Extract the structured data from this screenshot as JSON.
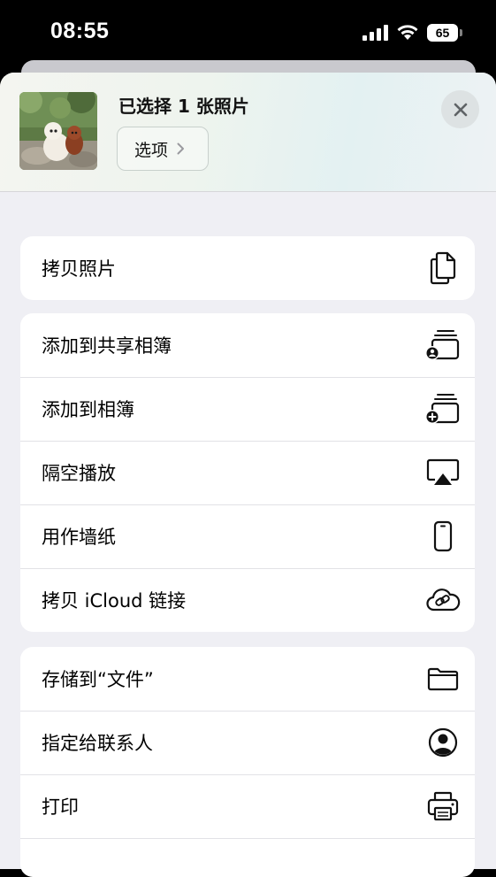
{
  "status_bar": {
    "time": "08:55",
    "battery": "65"
  },
  "header": {
    "title": "已选择 1 张照片",
    "options_label": "选项"
  },
  "groups": [
    {
      "rows": [
        {
          "label": "拷贝照片",
          "icon": "copy-icon"
        }
      ]
    },
    {
      "rows": [
        {
          "label": "添加到共享相簿",
          "icon": "shared-album-icon"
        },
        {
          "label": "添加到相簿",
          "icon": "add-album-icon"
        },
        {
          "label": "隔空播放",
          "icon": "airplay-icon"
        },
        {
          "label": "用作墙纸",
          "icon": "iphone-icon"
        },
        {
          "label": "拷贝 iCloud 链接",
          "icon": "icloud-link-icon"
        }
      ]
    },
    {
      "rows": [
        {
          "label": "存储到“文件”",
          "icon": "folder-icon"
        },
        {
          "label": "指定给联系人",
          "icon": "contact-icon"
        },
        {
          "label": "打印",
          "icon": "printer-icon"
        }
      ]
    }
  ]
}
